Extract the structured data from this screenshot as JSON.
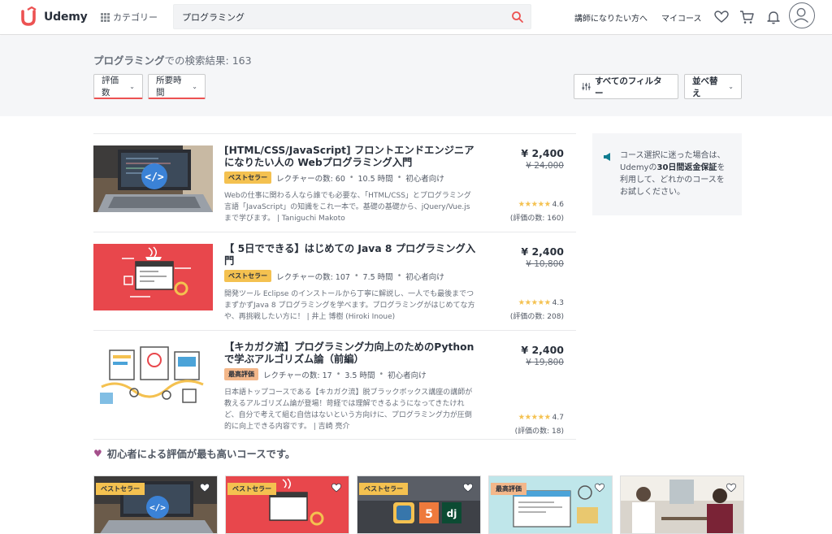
{
  "header": {
    "logo_text": "Udemy",
    "category_label": "カテゴリー",
    "search_value": "プログラミング",
    "instructor_link": "講師になりたい方へ",
    "my_courses_link": "マイコース"
  },
  "results": {
    "query": "プログラミング",
    "suffix": "での検索結果: 163"
  },
  "filters": {
    "rating": "評価数",
    "duration": "所要時間",
    "all_filters": "すべてのフィルター",
    "sort": "並べ替え"
  },
  "courses": [
    {
      "title": "[HTML/CSS/JavaScript] フロントエンドエンジニアになりたい人の Webプログラミング入門",
      "badge": "ベストセラー",
      "lectures": "レクチャーの数: 60",
      "hours": "10.5 時間",
      "level": "初心者向け",
      "desc": "Webの仕事に関わる人なら誰でも必要な、「HTML/CSS」とプログラミング言語「JavaScript」の知識をこれ一本で。基礎の基礎から、jQuery/Vue.jsまで学びます。 | Taniguchi Makoto",
      "price": "¥ 2,400",
      "old_price": "¥ 24,000",
      "rating": "4.6",
      "rating_value": 4.6,
      "rating_count": "(評価の数: 160)"
    },
    {
      "title": "【 5日でできる】はじめての Java 8 プログラミング入門",
      "badge": "ベストセラー",
      "lectures": "レクチャーの数: 107",
      "hours": "7.5 時間",
      "level": "初心者向け",
      "desc": "開発ツール Eclipse のインストールから丁寧に解説し、一人でも最後までつまずかずJava 8 プログラミングを学べます。プログラミングがはじめてな方や、再挑戦したい方に！ | 井上 博樹 (Hiroki Inoue)",
      "price": "¥ 2,400",
      "old_price": "¥ 10,800",
      "rating": "4.3",
      "rating_value": 4.3,
      "rating_count": "(評価の数: 208)"
    },
    {
      "title": "【キカガク流】プログラミング力向上のためのPythonで学ぶアルゴリズム論（前編）",
      "badge": "最高評価",
      "lectures": "レクチャーの数: 17",
      "hours": "3.5 時間",
      "level": "初心者向け",
      "desc": "日本語トップコースである【キカガク流】脱ブラックボックス講座の講師が教えるアルゴリズム論が登場！苛経では理解できるようになってきたけれど、自分で考えて組む自信はないという方向けに、プログラミング力が圧倒的に向上できる内容です。 | 吉崎 亮介",
      "price": "¥ 2,400",
      "old_price": "¥ 19,800",
      "rating": "4.7",
      "rating_value": 4.7,
      "rating_count": "(評価の数: 18)"
    }
  ],
  "sidebar": {
    "text_before": "コース選択に迷った場合は、Udemyの",
    "text_bold": "30日間返金保証",
    "text_after": "を利用して、どれかのコースをお試しください。"
  },
  "section": {
    "title": "初心者による評価が最も高いコースです。"
  },
  "cards": [
    {
      "badge": "ベストセラー",
      "badge_color": "#f4c150"
    },
    {
      "badge": "ベストセラー",
      "badge_color": "#f4c150"
    },
    {
      "badge": "ベストセラー",
      "badge_color": "#f4c150"
    },
    {
      "badge": "最高評価",
      "badge_color": "#f3b78a"
    },
    {
      "badge": "",
      "badge_color": ""
    }
  ],
  "colors": {
    "brand": "#ec5252",
    "star": "#f4c150",
    "heart": "#a44f8b"
  }
}
